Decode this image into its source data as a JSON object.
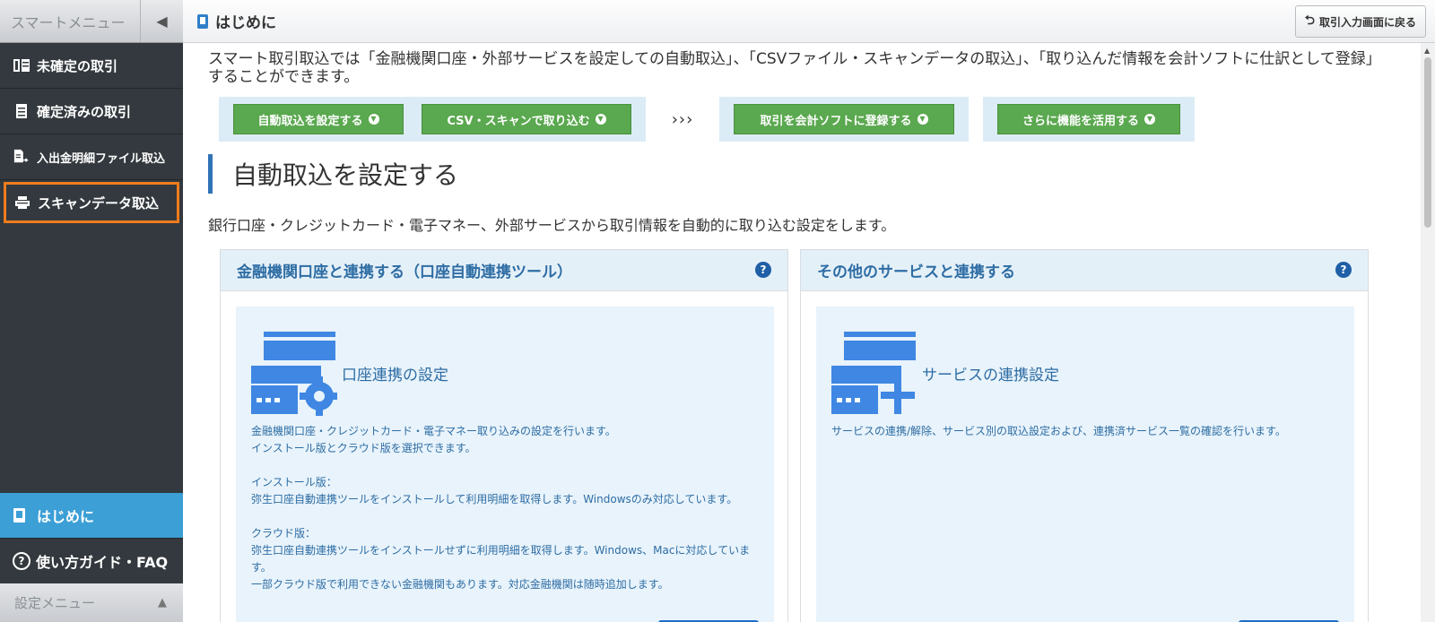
{
  "sidebar": {
    "title": "スマートメニュー",
    "items": [
      {
        "label": "未確定の取引"
      },
      {
        "label": "確定済みの取引"
      },
      {
        "label": "入出金明細ファイル取込"
      },
      {
        "label": "スキャンデータ取込"
      }
    ],
    "hajime": "はじめに",
    "guide": "使い方ガイド・FAQ",
    "settings": "設定メニュー"
  },
  "header": {
    "title": "はじめに",
    "back_label": "取引入力画面に戻る"
  },
  "main": {
    "intro": "スマート取引取込では「金融機関口座・外部サービスを設定しての自動取込」、「CSVファイル・スキャンデータの取込」、「取り込んだ情報を会計ソフトに仕訳として登録」することができます。",
    "flow_buttons": [
      "自動取込を設定する",
      "CSV・スキャンで取り込む",
      "取引を会計ソフトに登録する",
      "さらに機能を活用する"
    ],
    "chevrons": "›››",
    "section_title": "自動取込を設定する",
    "section_desc": "銀行口座・クレジットカード・電子マネー、外部サービスから取引情報を自動的に取り込む設定をします。",
    "cards": [
      {
        "header": "金融機関口座と連携する（口座自動連携ツール）",
        "subtitle": "口座連携の設定",
        "lines": [
          "金融機関口座・クレジットカード・電子マネー取り込みの設定を行います。",
          "インストール版とクラウド版を選択できます。",
          "",
          "インストール版：",
          "弥生口座自動連携ツールをインストールして利用明細を取得します。Windowsのみ対応しています。",
          "",
          "クラウド版：",
          "弥生口座自動連携ツールをインストールせずに利用明細を取得します。Windows、Macに対応しています。",
          "一部クラウド版で利用できない金融機関もあります。対応金融機関は随時追加します。"
        ]
      },
      {
        "header": "その他のサービスと連携する",
        "subtitle": "サービスの連携設定",
        "lines": [
          "サービスの連携/解除、サービス別の取込設定および、連携済サービス一覧の確認を行います。"
        ]
      }
    ]
  },
  "colors": {
    "sidebar_bg": "#33393e",
    "active_blue": "#3c9fd6",
    "highlight_orange": "#f07c1c",
    "green": "#5aa84f",
    "accent_blue": "#2e6da4"
  }
}
